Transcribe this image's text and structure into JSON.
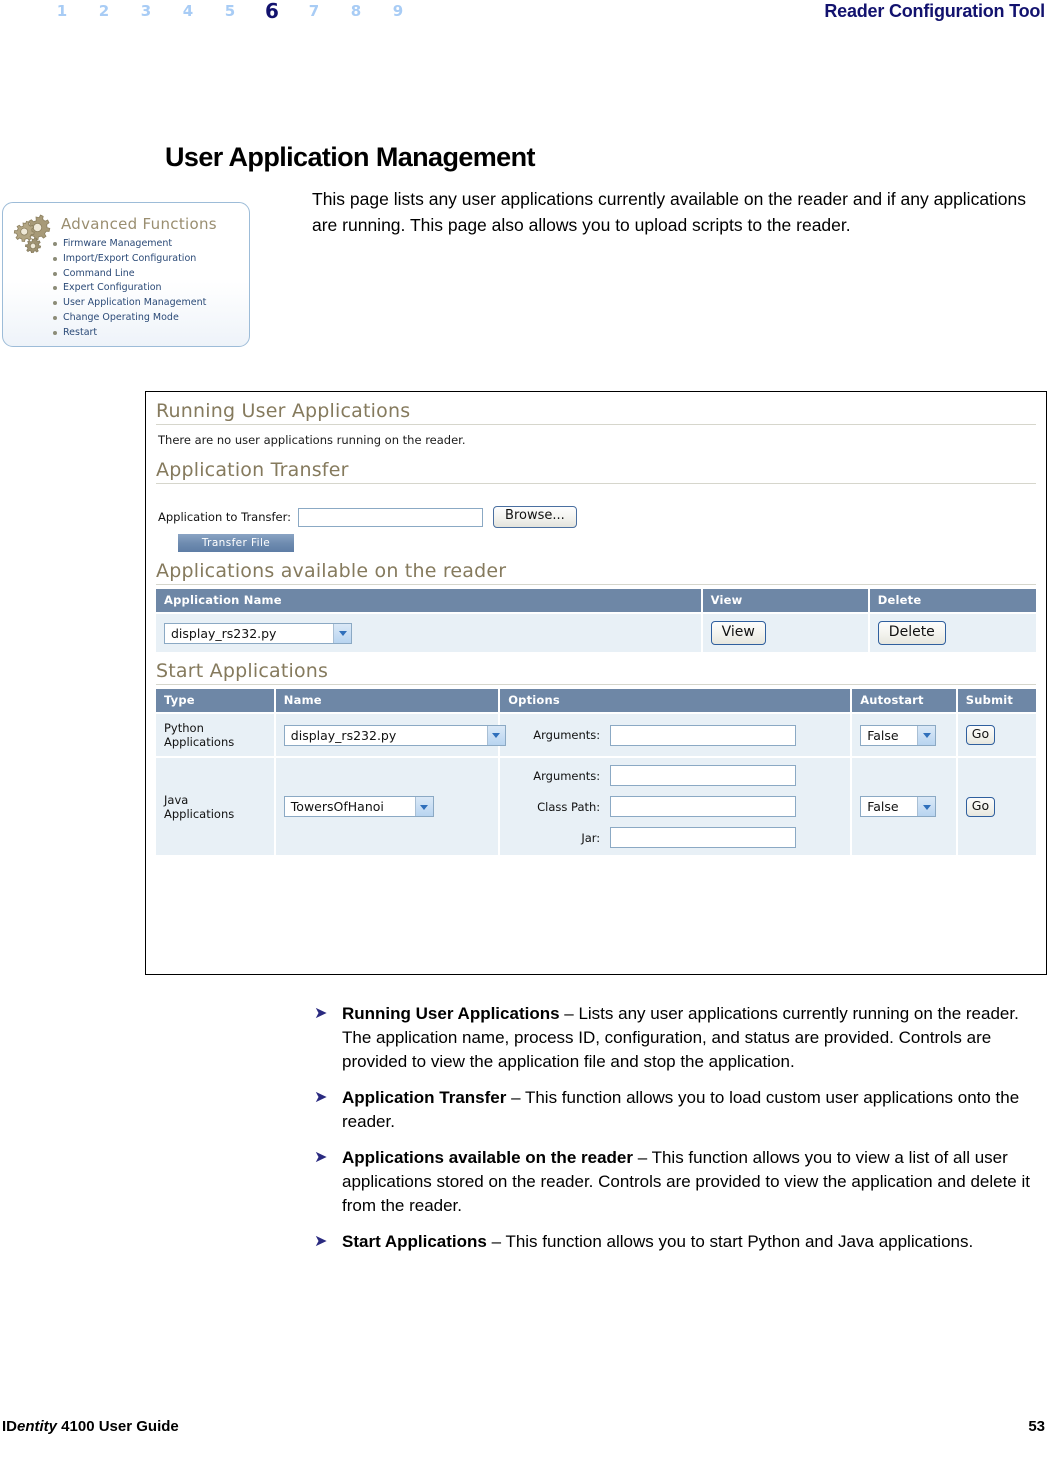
{
  "header": {
    "title": "Reader Configuration Tool",
    "page_numbers": [
      "1",
      "2",
      "3",
      "4",
      "5",
      "6",
      "7",
      "8",
      "9"
    ],
    "current_page_marker": "6",
    "accent_color": "#12126e",
    "inactive_color": "#a8ccf5"
  },
  "page_title": "User Application Management",
  "intro": "This page lists any user applications currently available on the reader and if any applications are running. This page also allows you to upload scripts to the reader.",
  "advanced_functions": {
    "icon": "gears-icon",
    "title": "Advanced Functions",
    "items": [
      "Firmware Management",
      "Import/Export Configuration",
      "Command Line",
      "Expert Configuration",
      "User Application Management",
      "Change Operating Mode",
      "Restart"
    ]
  },
  "screenshot": {
    "running": {
      "heading": "Running User Applications",
      "message": "There are no user applications running on the reader."
    },
    "transfer": {
      "heading": "Application Transfer",
      "label": "Application to Transfer:",
      "input_value": "",
      "browse_label": "Browse...",
      "submit_label": "Transfer File"
    },
    "available": {
      "heading": "Applications available on the reader",
      "columns": [
        "Application Name",
        "View",
        "Delete"
      ],
      "row": {
        "app_name": "display_rs232.py",
        "view_label": "View",
        "delete_label": "Delete"
      }
    },
    "start": {
      "heading": "Start Applications",
      "columns": [
        "Type",
        "Name",
        "Options",
        "Autostart",
        "Submit"
      ],
      "python": {
        "type_line1": "Python",
        "type_line2": "Applications",
        "name_value": "display_rs232.py",
        "options": [
          {
            "label": "Arguments:",
            "value": ""
          }
        ],
        "autostart_value": "False",
        "submit_label": "Go"
      },
      "java": {
        "type_line1": "Java",
        "type_line2": "Applications",
        "name_value": "TowersOfHanoi",
        "options": [
          {
            "label": "Arguments:",
            "value": ""
          },
          {
            "label": "Class Path:",
            "value": ""
          },
          {
            "label": "Jar:",
            "value": ""
          }
        ],
        "autostart_value": "False",
        "submit_label": "Go"
      }
    }
  },
  "bullets": [
    {
      "marker": "➤",
      "term": "Running User Applications",
      "rest": " – Lists any user applications currently running on the reader. The application name, process ID, configuration, and status are provided. Controls are provided to view the application file and stop the application."
    },
    {
      "marker": "➤",
      "term": "Application Transfer",
      "rest": " – This function allows you to load custom user applications onto the reader."
    },
    {
      "marker": "➤",
      "term": "Applications available on the reader",
      "rest": " – This function allows you to view a list of all user applications stored on the reader. Controls are provided to view the application and delete it from the reader."
    },
    {
      "marker": "➤",
      "term": "Start Applications",
      "rest": " – This function allows you to start Python and Java applications."
    }
  ],
  "footer": {
    "guide_prefix": "ID",
    "guide_italic": "entity",
    "guide_suffix": " 4100 User Guide",
    "page_number": "53"
  }
}
